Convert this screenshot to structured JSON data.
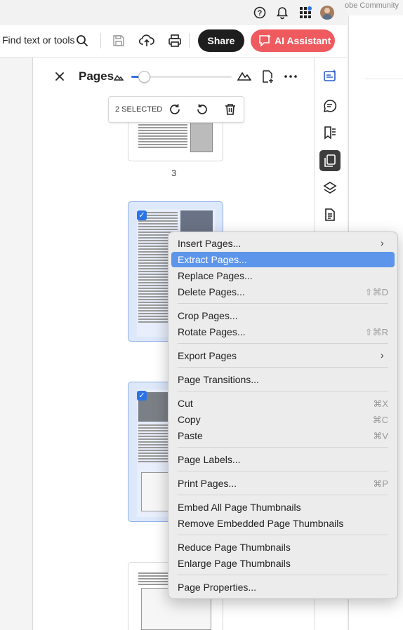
{
  "header": {
    "community_text": "obe Community",
    "help_icon": "help-icon",
    "notifications_icon": "bell-icon",
    "apps_icon": "apps-grid-icon",
    "avatar": "user-avatar"
  },
  "toolbar": {
    "find_label": "Find text or tools",
    "share_label": "Share",
    "ai_label": "AI Assistant",
    "accent_share": "#1e1e1e",
    "accent_ai": "#ef5a5f"
  },
  "pages_panel": {
    "title": "Pages",
    "selection_label": "2 SELECTED",
    "page_number": "3",
    "zoom_level": 0.12
  },
  "context_menu": {
    "items": [
      {
        "label": "Insert Pages...",
        "submenu": true,
        "shortcut": ""
      },
      {
        "label": "Extract Pages...",
        "highlighted": true,
        "shortcut": ""
      },
      {
        "label": "Replace Pages...",
        "shortcut": ""
      },
      {
        "label": "Delete Pages...",
        "shortcut": "⇧⌘D"
      },
      {
        "label": "Crop Pages...",
        "shortcut": ""
      },
      {
        "label": "Rotate Pages...",
        "shortcut": "⇧⌘R"
      },
      {
        "label": "Export Pages",
        "submenu": true,
        "shortcut": ""
      },
      {
        "label": "Page Transitions...",
        "shortcut": ""
      },
      {
        "label": "Cut",
        "shortcut": "⌘X"
      },
      {
        "label": "Copy",
        "shortcut": "⌘C"
      },
      {
        "label": "Paste",
        "shortcut": "⌘V"
      },
      {
        "label": "Page Labels...",
        "shortcut": ""
      },
      {
        "label": "Print Pages...",
        "shortcut": "⌘P"
      },
      {
        "label": "Embed All Page Thumbnails",
        "shortcut": ""
      },
      {
        "label": "Remove Embedded Page Thumbnails",
        "shortcut": ""
      },
      {
        "label": "Reduce Page Thumbnails",
        "shortcut": ""
      },
      {
        "label": "Enlarge Page Thumbnails",
        "shortcut": ""
      },
      {
        "label": "Page Properties...",
        "shortcut": ""
      }
    ],
    "highlight_color": "#5c95ea"
  },
  "right_rail": {
    "icons": [
      "ai-edit-icon",
      "comment-icon",
      "bookmark-icon",
      "pages-icon",
      "layers-icon",
      "document-icon"
    ],
    "active": "pages-icon"
  }
}
